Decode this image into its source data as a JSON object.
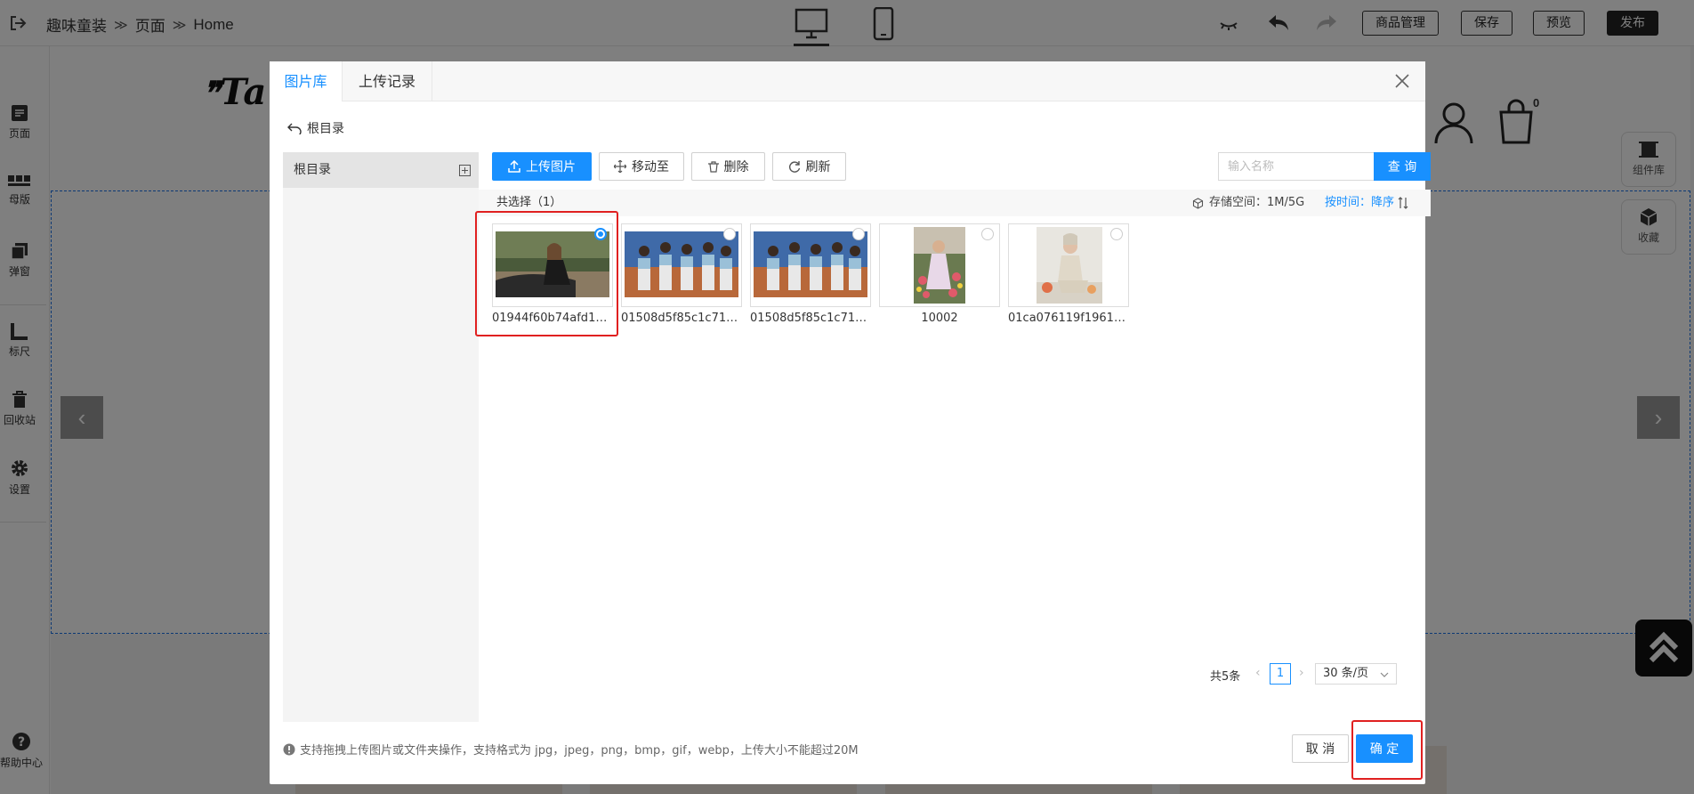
{
  "editor": {
    "breadcrumb": [
      "趣味童装",
      "页面",
      "Home"
    ],
    "breadcrumb_sep": "≫",
    "buttons": {
      "goods": "商品管理",
      "save": "保存",
      "preview": "预览",
      "publish": "发布"
    },
    "sidebar": [
      {
        "label": "页面",
        "icon": "page-icon"
      },
      {
        "label": "母版",
        "icon": "master-icon"
      },
      {
        "label": "弹窗",
        "icon": "popup-icon"
      },
      {
        "label": "标尺",
        "icon": "ruler-icon"
      },
      {
        "label": "回收站",
        "icon": "trash-icon"
      },
      {
        "label": "设置",
        "icon": "gear-icon"
      }
    ],
    "help": "帮助中心",
    "logo_text": "Ta",
    "side_tools": {
      "components": "组件库",
      "favorites": "收藏"
    },
    "cart_count": "0"
  },
  "modal": {
    "tabs": [
      "图片库",
      "上传记录"
    ],
    "back_label": "根目录",
    "directory": [
      "根目录"
    ],
    "toolbar": {
      "upload": "上传图片",
      "move": "移动至",
      "delete": "删除",
      "refresh": "刷新"
    },
    "search": {
      "placeholder": "输入名称",
      "button": "查 询"
    },
    "selected_count": "共选择（1）",
    "storage": "存储空间：1M/5G",
    "sort_label": "按时间：降序",
    "images": [
      {
        "name": "01944f60b74afd11...",
        "selected": true
      },
      {
        "name": "01508d5f85c1c711...",
        "selected": false
      },
      {
        "name": "01508d5f85c1c711...",
        "selected": false
      },
      {
        "name": "10002",
        "selected": false
      },
      {
        "name": "01ca076119f19611...",
        "selected": false
      }
    ],
    "pagination": {
      "total": "共5条",
      "current": "1",
      "page_size": "30 条/页"
    },
    "footer_tip": "支持拖拽上传图片或文件夹操作，支持格式为 jpg，jpeg，png，bmp，gif，webp，上传大小不能超过20M",
    "cancel": "取 消",
    "confirm": "确 定"
  }
}
